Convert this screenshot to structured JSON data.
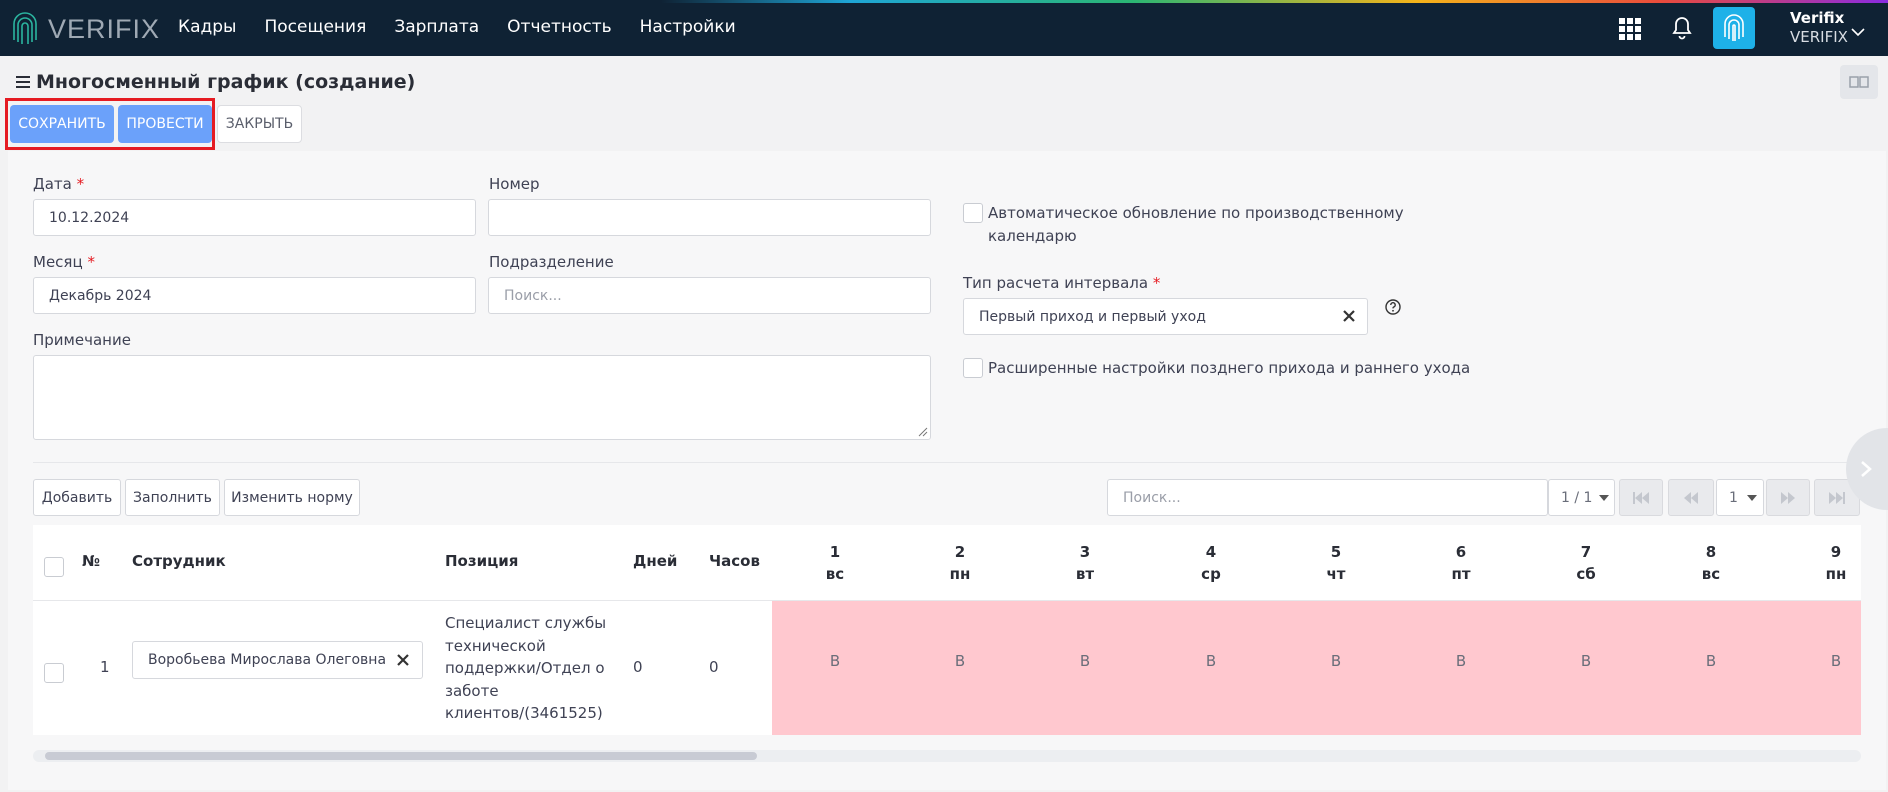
{
  "brand": {
    "logo_text": "VERIFIX"
  },
  "nav": {
    "menu": [
      "Кадры",
      "Посещения",
      "Зарплата",
      "Отчетность",
      "Настройки"
    ],
    "user_name": "Verifix",
    "user_org": "VERIFIX"
  },
  "page": {
    "title": "Многосменный график (создание)",
    "buttons": {
      "save": "СОХРАНИТЬ",
      "post": "ПРОВЕСТИ",
      "close": "ЗАКРЫТЬ"
    }
  },
  "form": {
    "date_label": "Дата",
    "date_value": "10.12.2024",
    "number_label": "Номер",
    "number_value": "",
    "month_label": "Месяц",
    "month_value": "Декабрь 2024",
    "division_label": "Подразделение",
    "division_placeholder": "Поиск...",
    "note_label": "Примечание",
    "required_mark": "*",
    "auto_update_label_1": "Автоматическое обновление по производственному",
    "auto_update_label_2": "календарю",
    "interval_type_label": "Тип расчета интервала",
    "interval_type_value": "Первый приход и первый уход",
    "advanced_label": "Расширенные настройки позднего прихода и раннего ухода"
  },
  "toolbar": {
    "add": "Добавить",
    "fill": "Заполнить",
    "change_norm": "Изменить норму",
    "search_placeholder": "Поиск...",
    "page_info": "1 / 1",
    "page_number": "1"
  },
  "table": {
    "headers": {
      "num": "№",
      "employee": "Сотрудник",
      "position": "Позиция",
      "days": "Дней",
      "hours": "Часов"
    },
    "days": [
      {
        "d": "1",
        "w": "вс"
      },
      {
        "d": "2",
        "w": "пн"
      },
      {
        "d": "3",
        "w": "вт"
      },
      {
        "d": "4",
        "w": "ср"
      },
      {
        "d": "5",
        "w": "чт"
      },
      {
        "d": "6",
        "w": "пт"
      },
      {
        "d": "7",
        "w": "сб"
      },
      {
        "d": "8",
        "w": "вс"
      },
      {
        "d": "9",
        "w": "пн"
      }
    ],
    "rows": [
      {
        "num": "1",
        "employee": "Воробьева Мирослава Олеговна",
        "position_lines": [
          "Специалист службы",
          "технической",
          "поддержки/Отдел о",
          "заботе",
          "клиентов/(3461525)"
        ],
        "days": "0",
        "hours": "0",
        "marks": [
          "В",
          "В",
          "В",
          "В",
          "В",
          "В",
          "В",
          "В",
          "В"
        ]
      }
    ]
  },
  "colors": {
    "nav_bg": "#0f2234",
    "primary": "#6ba1fa",
    "weekend_cell": "#ffc8cf",
    "highlight": "#e51b22",
    "fingerprint": "#1eb1e8"
  }
}
